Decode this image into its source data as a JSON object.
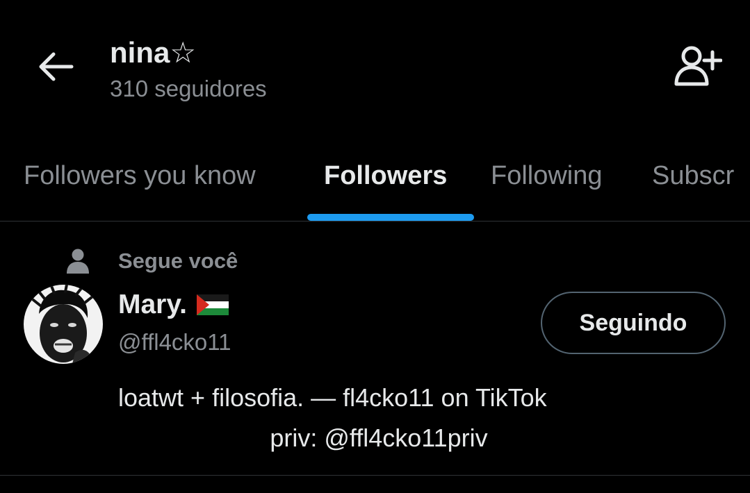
{
  "header": {
    "back_icon": "arrow-left-icon",
    "title": "nina☆",
    "subtitle": "310 seguidores",
    "add_user_icon": "person-plus-icon"
  },
  "tabs": [
    {
      "label": "Followers you know",
      "active": false
    },
    {
      "label": "Followers",
      "active": true
    },
    {
      "label": "Following",
      "active": false
    },
    {
      "label": "Subscr",
      "active": false
    }
  ],
  "list": {
    "items": [
      {
        "context_icon": "person-icon",
        "context_text": "Segue você",
        "avatar": "profile-photo",
        "name": "Mary.",
        "flag": "palestine-flag-emoji",
        "handle": "@ffl4cko11",
        "button_label": "Seguindo",
        "bio_line_1": "loatwt + filosofia. — fl4cko11 on TikTok",
        "bio_line_2": "priv: @ffl4cko11priv"
      }
    ]
  },
  "colors": {
    "background": "#000000",
    "text_primary": "#e7e9ea",
    "text_secondary": "#8b8f94",
    "accent": "#1d9bf0",
    "divider": "#2f3336",
    "button_border": "#536471"
  }
}
